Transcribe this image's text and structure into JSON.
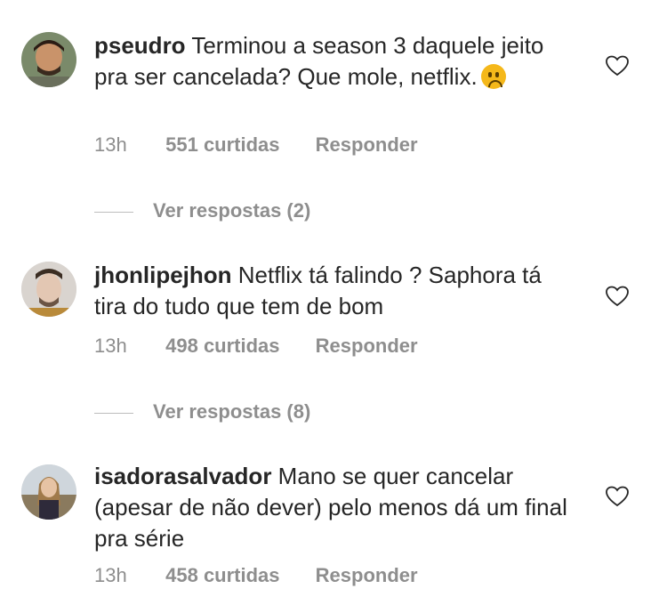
{
  "comments": [
    {
      "username": "pseudro",
      "text_before_emoji": "Terminou a season 3 daquele jeito pra ser cancelada? Que mole, netflix.",
      "emoji": "frowning-face",
      "time": "13h",
      "likes": "551 curtidas",
      "reply": "Responder",
      "view_replies": "Ver respostas (2)"
    },
    {
      "username": "jhonlipejhon",
      "text": "Netflix tá falindo ? Saphora tá tira do tudo que tem de bom",
      "time": "13h",
      "likes": "498 curtidas",
      "reply": "Responder",
      "view_replies": "Ver respostas (8)"
    },
    {
      "username": "isadorasalvador",
      "text": "Mano se quer cancelar (apesar de não dever) pelo menos dá um final pra série",
      "time": "13h",
      "likes": "458 curtidas",
      "reply": "Responder"
    }
  ],
  "icons": {
    "like": "heart-outline-icon"
  },
  "colors": {
    "text": "#262626",
    "secondary": "#8e8e8e"
  }
}
